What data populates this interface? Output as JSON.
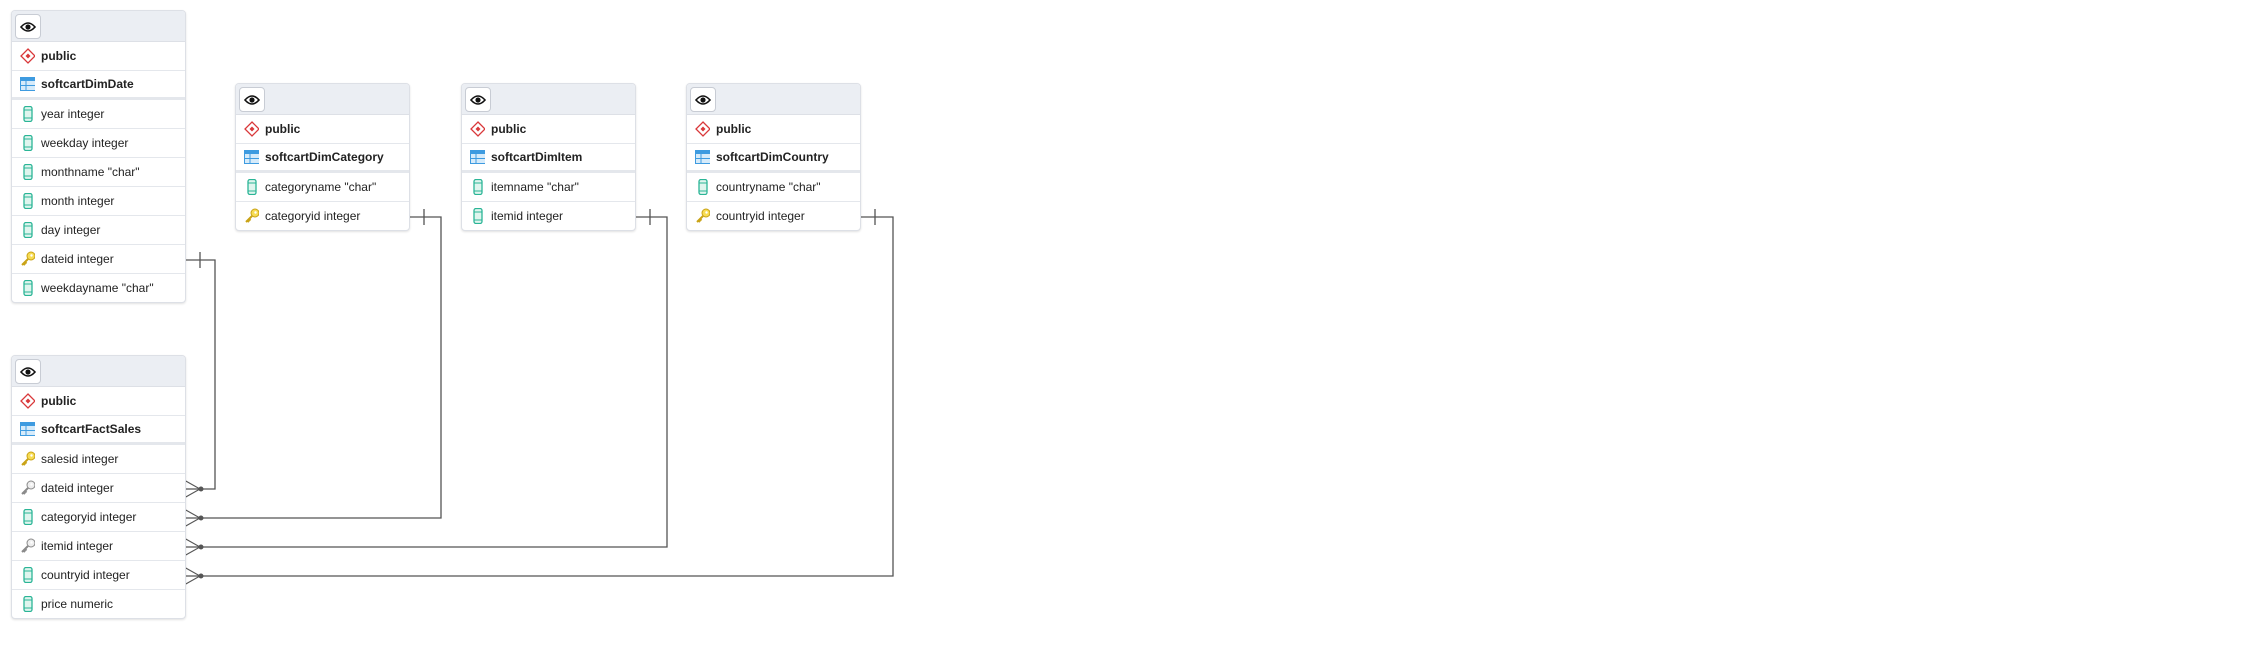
{
  "colors": {
    "schema": "#d9383a",
    "table": "#3e9be0",
    "column": "#2bb596",
    "pk": "#e3c12a",
    "fk": "#8a8a8a",
    "line": "#555555"
  },
  "tables": [
    {
      "id": "date",
      "schema": "public",
      "name": "softcartDimDate",
      "columns": [
        {
          "label": "year integer",
          "icon": "column-icon"
        },
        {
          "label": "weekday integer",
          "icon": "column-icon"
        },
        {
          "label": "monthname \"char\"",
          "icon": "column-icon"
        },
        {
          "label": "month integer",
          "icon": "column-icon"
        },
        {
          "label": "day integer",
          "icon": "column-icon"
        },
        {
          "label": "dateid integer",
          "icon": "primary-key-icon"
        },
        {
          "label": "weekdayname \"char\"",
          "icon": "column-icon"
        }
      ]
    },
    {
      "id": "category",
      "schema": "public",
      "name": "softcartDimCategory",
      "columns": [
        {
          "label": "categoryname \"char\"",
          "icon": "column-icon"
        },
        {
          "label": "categoryid integer",
          "icon": "primary-key-icon"
        }
      ]
    },
    {
      "id": "item",
      "schema": "public",
      "name": "softcartDimItem",
      "columns": [
        {
          "label": "itemname \"char\"",
          "icon": "column-icon"
        },
        {
          "label": "itemid integer",
          "icon": "column-icon"
        }
      ]
    },
    {
      "id": "country",
      "schema": "public",
      "name": "softcartDimCountry",
      "columns": [
        {
          "label": "countryname \"char\"",
          "icon": "column-icon"
        },
        {
          "label": "countryid integer",
          "icon": "primary-key-icon"
        }
      ]
    },
    {
      "id": "fact",
      "schema": "public",
      "name": "softcartFactSales",
      "columns": [
        {
          "label": "salesid integer",
          "icon": "primary-key-icon"
        },
        {
          "label": "dateid integer",
          "icon": "foreign-key-icon"
        },
        {
          "label": "categoryid integer",
          "icon": "column-icon"
        },
        {
          "label": "itemid integer",
          "icon": "foreign-key-icon"
        },
        {
          "label": "countryid integer",
          "icon": "column-icon"
        },
        {
          "label": "price numeric",
          "icon": "column-icon"
        }
      ]
    }
  ],
  "relations": [
    {
      "from": "fact.dateid",
      "to": "date.dateid"
    },
    {
      "from": "fact.categoryid",
      "to": "category.categoryid"
    },
    {
      "from": "fact.itemid",
      "to": "item.itemid"
    },
    {
      "from": "fact.countryid",
      "to": "country.countryid"
    }
  ]
}
